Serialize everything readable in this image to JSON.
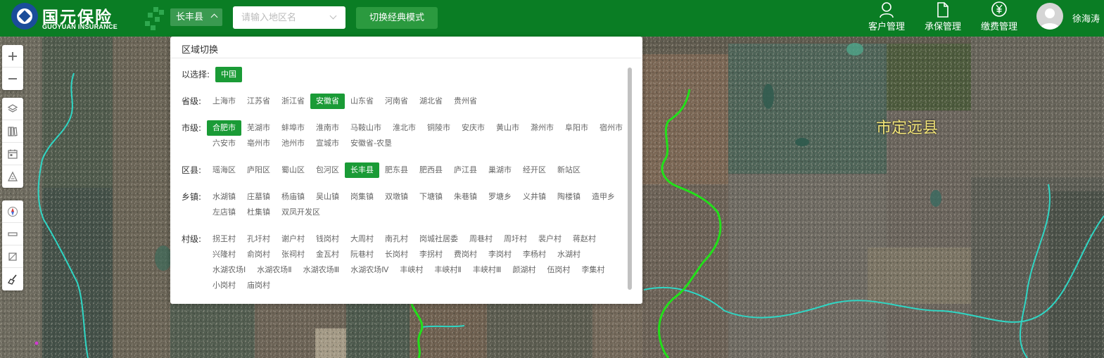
{
  "brand": {
    "name_cn": "国元保险",
    "name_en": "GUOYUAN INSURANCE",
    "color": "#0a7d24",
    "logo_color": "#1a4d9a"
  },
  "header": {
    "region_button": "长丰县",
    "search_placeholder": "请输入地区名",
    "classic_mode_button": "切换经典模式",
    "nav": [
      {
        "label": "客户管理",
        "icon": "user-icon"
      },
      {
        "label": "承保管理",
        "icon": "document-icon"
      },
      {
        "label": "缴费管理",
        "icon": "yuan-icon"
      }
    ],
    "user_name": "徐海涛"
  },
  "map": {
    "place_label": "市定远县"
  },
  "region_panel": {
    "title": "区域切换",
    "selected": {
      "label": "以选择:",
      "items": [
        "中国"
      ]
    },
    "province": {
      "label": "省级:",
      "items": [
        "上海市",
        "江苏省",
        "浙江省",
        "安徽省",
        "山东省",
        "河南省",
        "湖北省",
        "贵州省"
      ],
      "selected": "安徽省"
    },
    "city": {
      "label": "市级:",
      "items": [
        "合肥市",
        "芜湖市",
        "蚌埠市",
        "淮南市",
        "马鞍山市",
        "淮北市",
        "铜陵市",
        "安庆市",
        "黄山市",
        "滁州市",
        "阜阳市",
        "宿州市",
        "六安市",
        "亳州市",
        "池州市",
        "宣城市",
        "安徽省-农垦"
      ],
      "selected": "合肥市"
    },
    "district": {
      "label": "区县:",
      "items": [
        "瑶海区",
        "庐阳区",
        "蜀山区",
        "包河区",
        "长丰县",
        "肥东县",
        "肥西县",
        "庐江县",
        "巢湖市",
        "经开区",
        "新站区"
      ],
      "selected": "长丰县"
    },
    "town": {
      "label": "乡镇:",
      "items": [
        "水湖镇",
        "庄墓镇",
        "杨庙镇",
        "吴山镇",
        "岗集镇",
        "双墩镇",
        "下塘镇",
        "朱巷镇",
        "罗塘乡",
        "义井镇",
        "陶楼镇",
        "造甲乡",
        "左店镇",
        "杜集镇",
        "双凤开发区"
      ],
      "selected": ""
    },
    "village": {
      "label": "村级:",
      "items": [
        "拐王村",
        "孔圩村",
        "谢户村",
        "钱岗村",
        "大周村",
        "南孔村",
        "岗城社居委",
        "周巷村",
        "周圩村",
        "裴户村",
        "蒋赵村",
        "兴隆村",
        "俞岗村",
        "张祠村",
        "金瓦村",
        "阮巷村",
        "长岗村",
        "李拐村",
        "费岗村",
        "李岗村",
        "李杨村",
        "水湖村",
        "水湖农场Ⅰ",
        "水湖农场Ⅱ",
        "水湖农场Ⅲ",
        "水湖农场Ⅳ",
        "丰峡村",
        "丰峡村Ⅱ",
        "丰峡村Ⅲ",
        "颜湖村",
        "伍岗村",
        "李集村",
        "小岗村",
        "庙岗村"
      ],
      "selected": ""
    }
  },
  "map_tools": [
    {
      "name": "zoom-in",
      "icon": "plus-icon"
    },
    {
      "name": "zoom-out",
      "icon": "minus-icon"
    },
    {
      "name": "layers",
      "icon": "layers-icon"
    },
    {
      "name": "book",
      "icon": "book-icon"
    },
    {
      "name": "calendar",
      "icon": "calendar-icon"
    },
    {
      "name": "area",
      "icon": "area-icon"
    },
    {
      "name": "compass",
      "icon": "compass-icon"
    },
    {
      "name": "ruler",
      "icon": "ruler-icon"
    },
    {
      "name": "polygon",
      "icon": "polygon-icon"
    },
    {
      "name": "clear",
      "icon": "broom-icon"
    }
  ],
  "colors": {
    "accent": "#1a9b36",
    "boundary_green": "#22e01a",
    "boundary_cyan": "#2fd6c4",
    "map_label": "#f4e67a"
  }
}
